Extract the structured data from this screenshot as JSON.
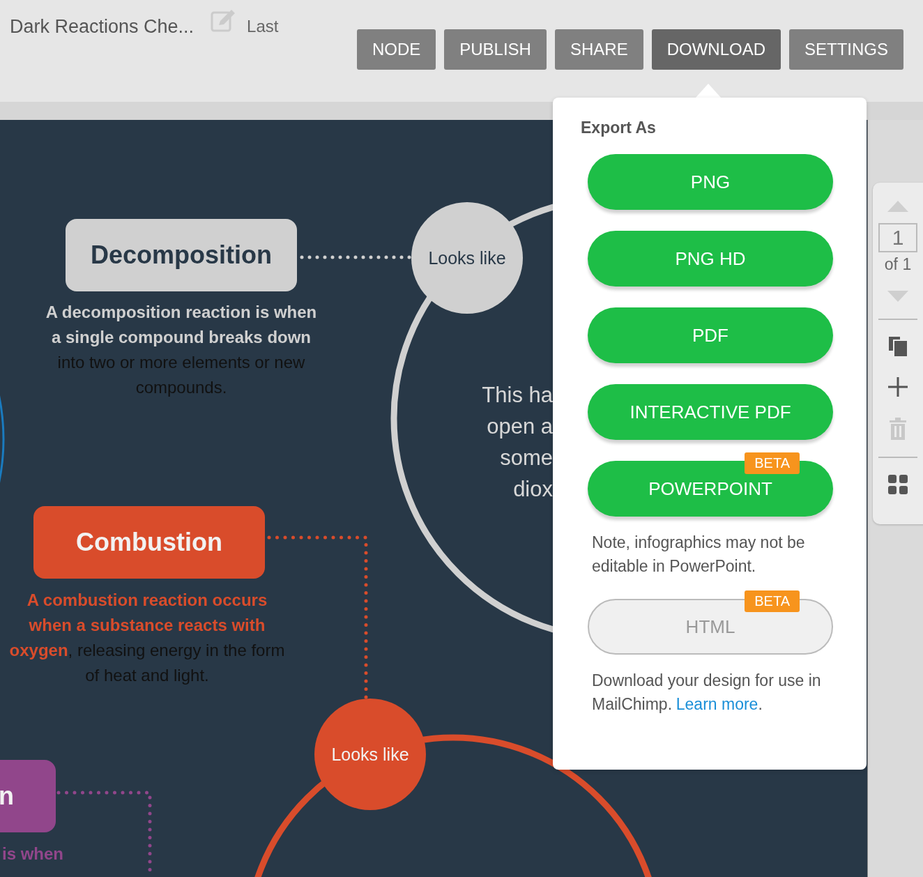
{
  "header": {
    "title": "Dark Reactions Che...",
    "status": "Last"
  },
  "menu": [
    {
      "label": "NODE",
      "selected": false
    },
    {
      "label": "PUBLISH",
      "selected": false
    },
    {
      "label": "SHARE",
      "selected": false
    },
    {
      "label": "DOWNLOAD",
      "selected": true
    },
    {
      "label": "SETTINGS",
      "selected": false
    }
  ],
  "canvas": {
    "categories": [
      {
        "title": "Decomposition",
        "color": "#d0d0d0",
        "description": "**A decomposition reaction is when a single compound breaks down** into two or more elements or new compounds."
      },
      {
        "title": "Combustion",
        "color": "#d94c2b",
        "description": "**A combustion reaction occurs when a substance reacts with oxygen**, releasing energy in the form of heat and light."
      },
      {
        "title": "n",
        "color": "#91468b",
        "description": "**is when**"
      }
    ],
    "bubbles": [
      {
        "label": "Looks like",
        "color": "#d0d0d0"
      },
      {
        "label": "Looks like",
        "color": "#d94c2b"
      }
    ],
    "snippet": [
      "This ha",
      "open a",
      "some",
      "diox"
    ]
  },
  "export": {
    "title": "Export As",
    "items": [
      {
        "kind": "filled",
        "label": "PNG"
      },
      {
        "kind": "filled",
        "label": "PNG HD"
      },
      {
        "kind": "filled",
        "label": "PDF"
      },
      {
        "kind": "filled",
        "label": "INTERACTIVE PDF"
      },
      {
        "kind": "filled",
        "label": "POWERPOINT",
        "badge": "BETA"
      },
      {
        "kind": "note",
        "text": "Note, infographics may not be editable in PowerPoint."
      },
      {
        "kind": "outline",
        "label": "HTML",
        "badge": "BETA"
      },
      {
        "kind": "note",
        "text": "Download your design for use in MailChimp.",
        "link": "Learn more",
        "after_link": "."
      }
    ]
  },
  "pager": {
    "page": "1",
    "total": "of 1"
  }
}
